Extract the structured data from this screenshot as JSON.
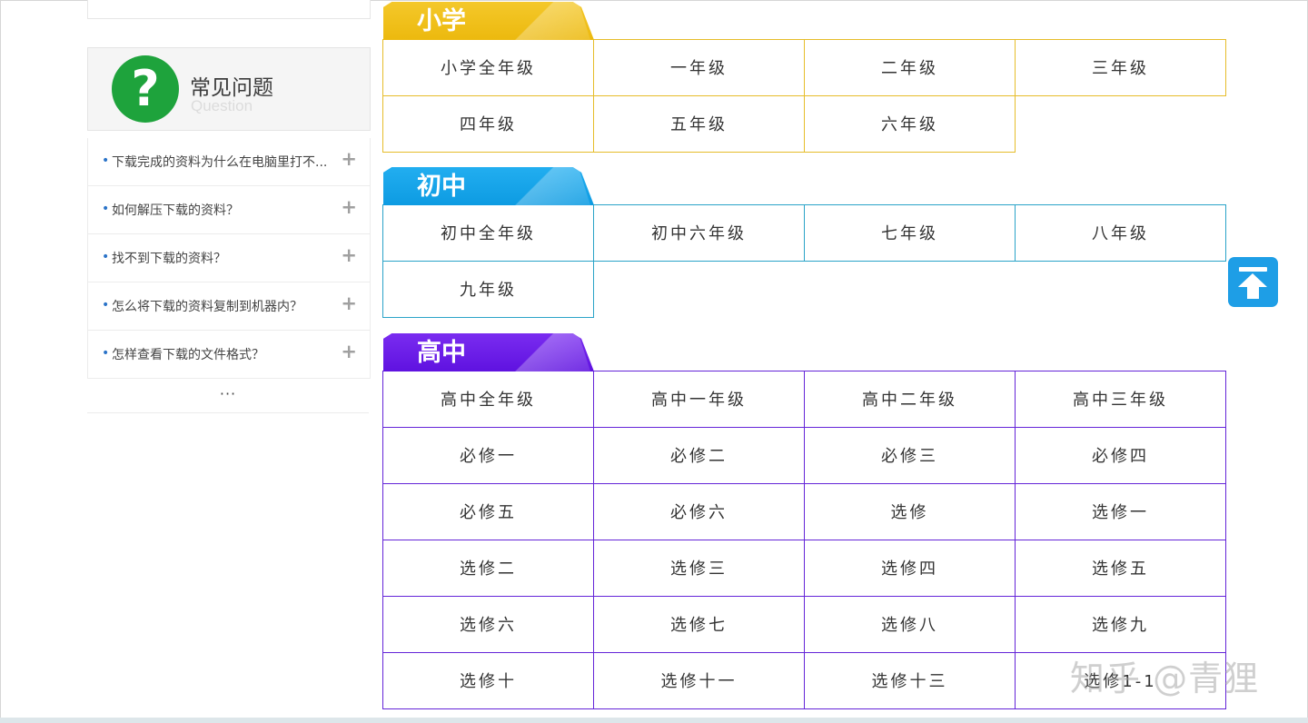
{
  "faq": {
    "title": "常见问题",
    "subtitle": "Question",
    "icon": "question-mark-icon",
    "items": [
      {
        "question": "下载完成的资料为什么在电脑里打不..."
      },
      {
        "question": "如何解压下载的资料？"
      },
      {
        "question": "找不到下载的资料？"
      },
      {
        "question": "怎么将下载的资料复制到机器内？"
      },
      {
        "question": "怎样查看下载的文件格式？"
      }
    ],
    "expand_symbol": "+",
    "bullet": "•",
    "more": "···"
  },
  "sections": {
    "primary": {
      "label": "小学",
      "color": "#ecb90e",
      "grades": [
        "小学全年级",
        "一年级",
        "二年级",
        "三年级",
        "四年级",
        "五年级",
        "六年级"
      ]
    },
    "junior": {
      "label": "初中",
      "color": "#0d9be2",
      "grades": [
        "初中全年级",
        "初中六年级",
        "七年级",
        "八年级",
        "九年级"
      ]
    },
    "senior": {
      "label": "高中",
      "color": "#5f12e0",
      "grades": [
        "高中全年级",
        "高中一年级",
        "高中二年级",
        "高中三年级",
        "必修一",
        "必修二",
        "必修三",
        "必修四",
        "必修五",
        "必修六",
        "选修",
        "选修一",
        "选修二",
        "选修三",
        "选修四",
        "选修五",
        "选修六",
        "选修七",
        "选修八",
        "选修九",
        "选修十",
        "选修十一",
        "选修十三",
        "选修1-1"
      ]
    }
  },
  "back_to_top": {
    "icon": "arrow-up-to-top-icon",
    "color": "#1e9ee6"
  },
  "watermark": "知乎 @青狸"
}
